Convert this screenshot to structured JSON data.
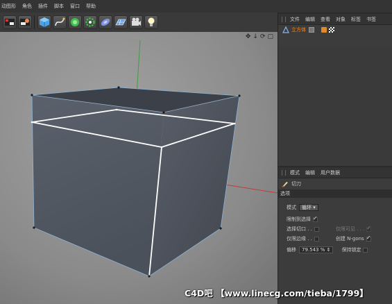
{
  "menu": [
    "动图形",
    "角色",
    "插件",
    "脚本",
    "窗口",
    "帮助"
  ],
  "toolbar": {
    "icons": [
      "render-view-icon",
      "render-settings-icon",
      "cube-icon",
      "spline-pen-icon",
      "nurbs-icon",
      "array-icon",
      "deformer-icon",
      "plane-grid-icon",
      "camera-icon",
      "light-icon"
    ]
  },
  "viewport": {
    "nav_icons": [
      "✥",
      "↓",
      "⟳",
      "▢"
    ]
  },
  "object_manager": {
    "menu": [
      "文件",
      "编辑",
      "查看",
      "对象",
      "标签",
      "书签"
    ],
    "object_name": "立方体"
  },
  "attribute_manager": {
    "menu": [
      "模式",
      "编辑",
      "用户数据"
    ],
    "tool_name": "切刀",
    "section": "选项",
    "mode_label": "模式",
    "mode_value": "循环",
    "restrict_label": "限制到选择",
    "select_loop_label": "选择切口 . .",
    "visible_only_label": "仅限可见 . . .",
    "border_only_label": "仅限边缘 . .",
    "create_ngons_label": "创建 N-gons",
    "offset_label": "偏移",
    "offset_value": "79.543 %",
    "keep_locked_label": "保持锁定"
  },
  "colors": {
    "cube_face": "#565d68",
    "cube_top": "#3f444c",
    "cut_line": "#ffffff",
    "axis_x": "#c23a3a",
    "axis_y": "#3f9d3f",
    "object_orange": "#ff8a1a"
  },
  "watermark": "C4D吧 【www.linecg.com/tieba/1799】"
}
